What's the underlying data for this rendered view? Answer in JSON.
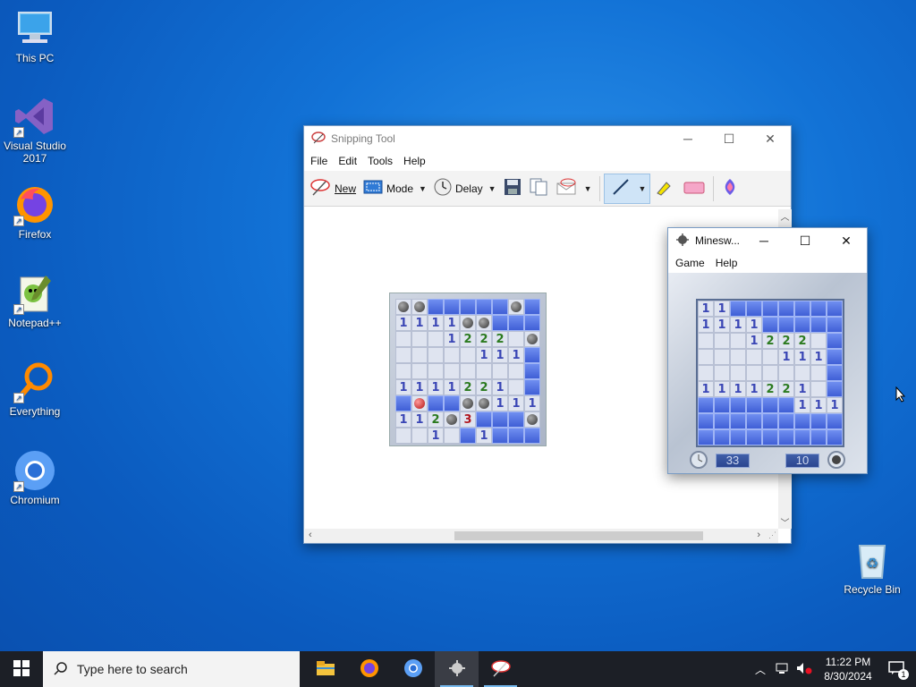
{
  "desktop": {
    "icons": [
      {
        "label": "This PC",
        "icon": "computer-icon"
      },
      {
        "label": "Visual Studio 2017",
        "icon": "visual-studio-icon"
      },
      {
        "label": "Firefox",
        "icon": "firefox-icon"
      },
      {
        "label": "Notepad++",
        "icon": "notepad-plus-plus-icon"
      },
      {
        "label": "Everything",
        "icon": "everything-search-icon"
      },
      {
        "label": "Chromium",
        "icon": "chromium-icon"
      },
      {
        "label": "Recycle Bin",
        "icon": "recycle-bin-icon"
      }
    ]
  },
  "snipping_tool": {
    "title": "Snipping Tool",
    "menu": [
      "File",
      "Edit",
      "Tools",
      "Help"
    ],
    "toolbar": {
      "new": "New",
      "mode": "Mode",
      "delay": "Delay"
    },
    "captured_grid": [
      "MGCCCCCGCCCCCCGC",
      "1111GGCC",
      "00012220GC",
      "00000111",
      "00000000",
      "11112210",
      "CRCCGG111",
      "112G3CCCG",
      "0010C1CCC"
    ]
  },
  "minesweeper": {
    "title": "Minesw...",
    "menu": [
      "Game",
      "Help"
    ],
    "grid": [
      "11CCCCCCC",
      "1111CCCCC",
      "00012220CC",
      "00000111",
      "00000000",
      "11112210",
      "CCCCCC111",
      "CCCCCCCCC",
      "CCCCCCCCC"
    ],
    "timer": "33",
    "mines_left": "10"
  },
  "taskbar": {
    "search_placeholder": "Type here to search",
    "time": "11:22 PM",
    "date": "8/30/2024",
    "notification_count": "1",
    "apps": [
      "file-explorer-icon",
      "firefox-icon",
      "chromium-icon",
      "minesweeper-icon",
      "snipping-tool-icon"
    ]
  },
  "colors": {
    "accent": "#0078d7",
    "taskbar": "#1c1f26",
    "ms_cover": "#4a6adf"
  }
}
